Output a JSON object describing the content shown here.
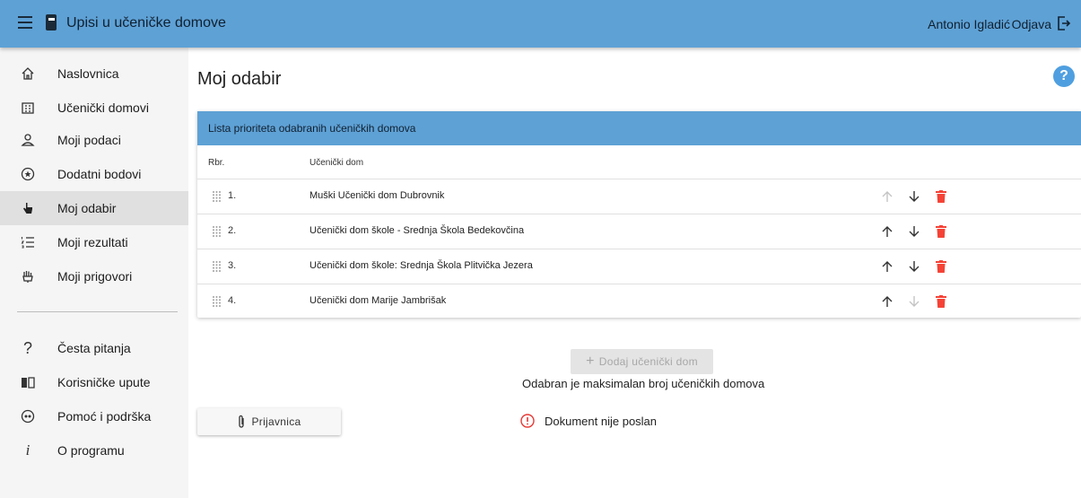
{
  "header": {
    "app_title": "Upisi u učeničke domove",
    "user_name": "Antonio Igladić",
    "logout_label": "Odjava"
  },
  "sidebar": {
    "items": [
      {
        "label": "Naslovnica",
        "icon": "home-icon"
      },
      {
        "label": "Učenički domovi",
        "icon": "building-icon"
      },
      {
        "label": "Moji podaci",
        "icon": "person-icon"
      },
      {
        "label": "Dodatni bodovi",
        "icon": "badge-star-icon"
      },
      {
        "label": "Moj odabir",
        "icon": "hand-pointer-icon",
        "active": true
      },
      {
        "label": "Moji rezultati",
        "icon": "list-numbered-icon"
      },
      {
        "label": "Moji prigovori",
        "icon": "hand-raised-icon"
      }
    ],
    "secondary_items": [
      {
        "label": "Česta pitanja",
        "icon": "question-icon"
      },
      {
        "label": "Korisničke upute",
        "icon": "book-icon"
      },
      {
        "label": "Pomoć i podrška",
        "icon": "support-icon"
      },
      {
        "label": "O programu",
        "icon": "info-icon"
      }
    ]
  },
  "main": {
    "title": "Moj odabir",
    "help_label": "?",
    "card_title": "Lista prioriteta odabranih učeničkih domova",
    "columns": {
      "rbr": "Rbr.",
      "dom": "Učenički dom"
    },
    "rows": [
      {
        "rbr": "1.",
        "name": "Muški Učenički dom Dubrovnik",
        "up_enabled": false,
        "down_enabled": true
      },
      {
        "rbr": "2.",
        "name": "Učenički dom škole - Srednja Škola Bedekovčina",
        "up_enabled": true,
        "down_enabled": true
      },
      {
        "rbr": "3.",
        "name": "Učenički dom škole: Srednja Škola Plitvička Jezera",
        "up_enabled": true,
        "down_enabled": true
      },
      {
        "rbr": "4.",
        "name": "Učenički dom Marije Jambrišak",
        "up_enabled": true,
        "down_enabled": false
      }
    ],
    "add_button_label": "Dodaj učenički dom",
    "max_note": "Odabran je maksimalan broj učeničkih domova",
    "prijavnica_label": "Prijavnica",
    "document_status": "Dokument nije poslan"
  },
  "colors": {
    "header_blue": "#5ea1d5",
    "help_blue": "#4f9fe0",
    "delete_red": "#f44336",
    "status_red": "#e53935"
  }
}
